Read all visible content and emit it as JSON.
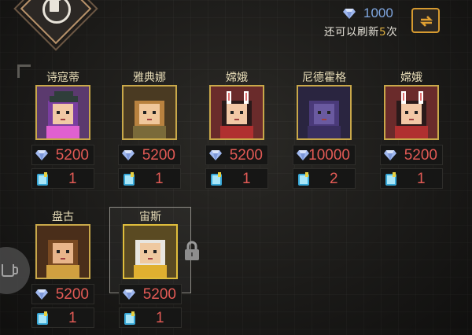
{
  "currency": {
    "amount": "1000",
    "icon": "diamond-icon",
    "color": "#7fa6df"
  },
  "refresh": {
    "prefix": "还可以刷新",
    "count": "5",
    "suffix": "次",
    "button_icon": "refresh-arrows-icon"
  },
  "heroes": [
    {
      "name": "诗寇蒂",
      "cost": "5200",
      "tickets": "1"
    },
    {
      "name": "雅典娜",
      "cost": "5200",
      "tickets": "1"
    },
    {
      "name": "嫦娥",
      "cost": "5200",
      "tickets": "1"
    },
    {
      "name": "尼德霍格",
      "cost": "10000",
      "tickets": "2"
    },
    {
      "name": "嫦娥",
      "cost": "5200",
      "tickets": "1"
    },
    {
      "name": "盘古",
      "cost": "5200",
      "tickets": "1"
    },
    {
      "name": "宙斯",
      "cost": "5200",
      "tickets": "1",
      "selected": true,
      "locked": true
    }
  ]
}
